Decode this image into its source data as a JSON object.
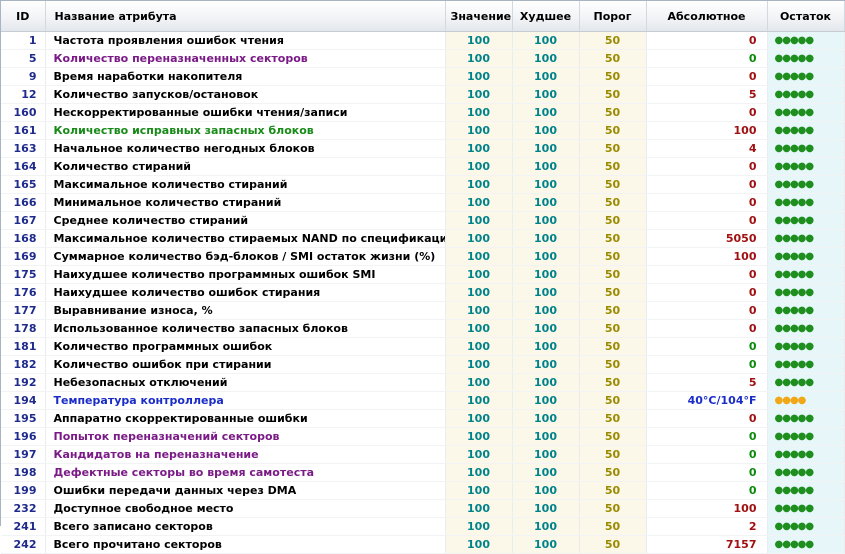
{
  "headers": {
    "id": "ID",
    "name": "Название атрибута",
    "value": "Значение",
    "worst": "Худшее",
    "threshold": "Порог",
    "raw": "Абсолютное",
    "remaining": "Остаток"
  },
  "colors": {
    "id": "#1e2a8c",
    "name_default": "#000000",
    "name_purple": "#7a1a86",
    "name_green": "#178a17",
    "name_blue": "#1a2cc8",
    "value": "#00828a",
    "threshold": "#9a8a00",
    "raw_red": "#a01010",
    "raw_green": "#0a8a0a",
    "raw_blue": "#1a2cc8",
    "dots_green": "#1e8f1e",
    "dots_orange": "#f0a818"
  },
  "rows": [
    {
      "id": "1",
      "name": "Частота проявления ошибок чтения",
      "name_color": "#000000",
      "value": "100",
      "worst": "100",
      "threshold": "50",
      "raw": "0",
      "raw_color": "#a01010",
      "remaining": "●●●●●",
      "rem_color": "#1e8f1e"
    },
    {
      "id": "5",
      "name": "Количество переназначенных секторов",
      "name_color": "#7a1a86",
      "value": "100",
      "worst": "100",
      "threshold": "50",
      "raw": "0",
      "raw_color": "#0a8a0a",
      "remaining": "●●●●●",
      "rem_color": "#1e8f1e"
    },
    {
      "id": "9",
      "name": "Время наработки накопителя",
      "name_color": "#000000",
      "value": "100",
      "worst": "100",
      "threshold": "50",
      "raw": "0",
      "raw_color": "#a01010",
      "remaining": "●●●●●",
      "rem_color": "#1e8f1e"
    },
    {
      "id": "12",
      "name": "Количество запусков/остановок",
      "name_color": "#000000",
      "value": "100",
      "worst": "100",
      "threshold": "50",
      "raw": "5",
      "raw_color": "#a01010",
      "remaining": "●●●●●",
      "rem_color": "#1e8f1e"
    },
    {
      "id": "160",
      "name": "Нескорректированные ошибки чтения/записи",
      "name_color": "#000000",
      "value": "100",
      "worst": "100",
      "threshold": "50",
      "raw": "0",
      "raw_color": "#a01010",
      "remaining": "●●●●●",
      "rem_color": "#1e8f1e"
    },
    {
      "id": "161",
      "name": "Количество исправных запасных блоков",
      "name_color": "#178a17",
      "value": "100",
      "worst": "100",
      "threshold": "50",
      "raw": "100",
      "raw_color": "#a01010",
      "remaining": "●●●●●",
      "rem_color": "#1e8f1e"
    },
    {
      "id": "163",
      "name": "Начальное количество негодных блоков",
      "name_color": "#000000",
      "value": "100",
      "worst": "100",
      "threshold": "50",
      "raw": "4",
      "raw_color": "#a01010",
      "remaining": "●●●●●",
      "rem_color": "#1e8f1e"
    },
    {
      "id": "164",
      "name": "Количество стираний",
      "name_color": "#000000",
      "value": "100",
      "worst": "100",
      "threshold": "50",
      "raw": "0",
      "raw_color": "#a01010",
      "remaining": "●●●●●",
      "rem_color": "#1e8f1e"
    },
    {
      "id": "165",
      "name": "Максимальное количество стираний",
      "name_color": "#000000",
      "value": "100",
      "worst": "100",
      "threshold": "50",
      "raw": "0",
      "raw_color": "#a01010",
      "remaining": "●●●●●",
      "rem_color": "#1e8f1e"
    },
    {
      "id": "166",
      "name": "Минимальное количество стираний",
      "name_color": "#000000",
      "value": "100",
      "worst": "100",
      "threshold": "50",
      "raw": "0",
      "raw_color": "#a01010",
      "remaining": "●●●●●",
      "rem_color": "#1e8f1e"
    },
    {
      "id": "167",
      "name": "Среднее количество стираний",
      "name_color": "#000000",
      "value": "100",
      "worst": "100",
      "threshold": "50",
      "raw": "0",
      "raw_color": "#a01010",
      "remaining": "●●●●●",
      "rem_color": "#1e8f1e"
    },
    {
      "id": "168",
      "name": "Максимальное количество стираемых NAND по спецификации",
      "name_color": "#000000",
      "value": "100",
      "worst": "100",
      "threshold": "50",
      "raw": "5050",
      "raw_color": "#a01010",
      "remaining": "●●●●●",
      "rem_color": "#1e8f1e"
    },
    {
      "id": "169",
      "name": "Суммарное количество бэд-блоков / SMI остаток жизни (%)",
      "name_color": "#000000",
      "value": "100",
      "worst": "100",
      "threshold": "50",
      "raw": "100",
      "raw_color": "#a01010",
      "remaining": "●●●●●",
      "rem_color": "#1e8f1e"
    },
    {
      "id": "175",
      "name": "Наихудшее количество программных ошибок SMI",
      "name_color": "#000000",
      "value": "100",
      "worst": "100",
      "threshold": "50",
      "raw": "0",
      "raw_color": "#a01010",
      "remaining": "●●●●●",
      "rem_color": "#1e8f1e"
    },
    {
      "id": "176",
      "name": "Наихудшее количество ошибок стирания",
      "name_color": "#000000",
      "value": "100",
      "worst": "100",
      "threshold": "50",
      "raw": "0",
      "raw_color": "#a01010",
      "remaining": "●●●●●",
      "rem_color": "#1e8f1e"
    },
    {
      "id": "177",
      "name": "Выравнивание износа, %",
      "name_color": "#000000",
      "value": "100",
      "worst": "100",
      "threshold": "50",
      "raw": "0",
      "raw_color": "#a01010",
      "remaining": "●●●●●",
      "rem_color": "#1e8f1e"
    },
    {
      "id": "178",
      "name": "Использованное количество запасных блоков",
      "name_color": "#000000",
      "value": "100",
      "worst": "100",
      "threshold": "50",
      "raw": "0",
      "raw_color": "#a01010",
      "remaining": "●●●●●",
      "rem_color": "#1e8f1e"
    },
    {
      "id": "181",
      "name": "Количество программных ошибок",
      "name_color": "#000000",
      "value": "100",
      "worst": "100",
      "threshold": "50",
      "raw": "0",
      "raw_color": "#0a8a0a",
      "remaining": "●●●●●",
      "rem_color": "#1e8f1e"
    },
    {
      "id": "182",
      "name": "Количество ошибок при стирании",
      "name_color": "#000000",
      "value": "100",
      "worst": "100",
      "threshold": "50",
      "raw": "0",
      "raw_color": "#0a8a0a",
      "remaining": "●●●●●",
      "rem_color": "#1e8f1e"
    },
    {
      "id": "192",
      "name": "Небезопасных отключений",
      "name_color": "#000000",
      "value": "100",
      "worst": "100",
      "threshold": "50",
      "raw": "5",
      "raw_color": "#a01010",
      "remaining": "●●●●●",
      "rem_color": "#1e8f1e"
    },
    {
      "id": "194",
      "name": "Температура контроллера",
      "name_color": "#1a2cc8",
      "value": "100",
      "worst": "100",
      "threshold": "50",
      "raw": "40°C/104°F",
      "raw_color": "#1a2cc8",
      "remaining": "●●●●",
      "rem_color": "#f0a818"
    },
    {
      "id": "195",
      "name": "Аппаратно скорректированные ошибки",
      "name_color": "#000000",
      "value": "100",
      "worst": "100",
      "threshold": "50",
      "raw": "0",
      "raw_color": "#a01010",
      "remaining": "●●●●●",
      "rem_color": "#1e8f1e"
    },
    {
      "id": "196",
      "name": "Попыток переназначений секторов",
      "name_color": "#7a1a86",
      "value": "100",
      "worst": "100",
      "threshold": "50",
      "raw": "0",
      "raw_color": "#0a8a0a",
      "remaining": "●●●●●",
      "rem_color": "#1e8f1e"
    },
    {
      "id": "197",
      "name": "Кандидатов на переназначение",
      "name_color": "#7a1a86",
      "value": "100",
      "worst": "100",
      "threshold": "50",
      "raw": "0",
      "raw_color": "#0a8a0a",
      "remaining": "●●●●●",
      "rem_color": "#1e8f1e"
    },
    {
      "id": "198",
      "name": "Дефектные секторы во время самотеста",
      "name_color": "#7a1a86",
      "value": "100",
      "worst": "100",
      "threshold": "50",
      "raw": "0",
      "raw_color": "#0a8a0a",
      "remaining": "●●●●●",
      "rem_color": "#1e8f1e"
    },
    {
      "id": "199",
      "name": "Ошибки передачи данных через DMA",
      "name_color": "#000000",
      "value": "100",
      "worst": "100",
      "threshold": "50",
      "raw": "0",
      "raw_color": "#0a8a0a",
      "remaining": "●●●●●",
      "rem_color": "#1e8f1e"
    },
    {
      "id": "232",
      "name": "Доступное свободное место",
      "name_color": "#000000",
      "value": "100",
      "worst": "100",
      "threshold": "50",
      "raw": "100",
      "raw_color": "#a01010",
      "remaining": "●●●●●",
      "rem_color": "#1e8f1e"
    },
    {
      "id": "241",
      "name": "Всего записано секторов",
      "name_color": "#000000",
      "value": "100",
      "worst": "100",
      "threshold": "50",
      "raw": "2",
      "raw_color": "#a01010",
      "remaining": "●●●●●",
      "rem_color": "#1e8f1e"
    },
    {
      "id": "242",
      "name": "Всего прочитано секторов",
      "name_color": "#000000",
      "value": "100",
      "worst": "100",
      "threshold": "50",
      "raw": "7157",
      "raw_color": "#a01010",
      "remaining": "●●●●●",
      "rem_color": "#1e8f1e"
    }
  ]
}
